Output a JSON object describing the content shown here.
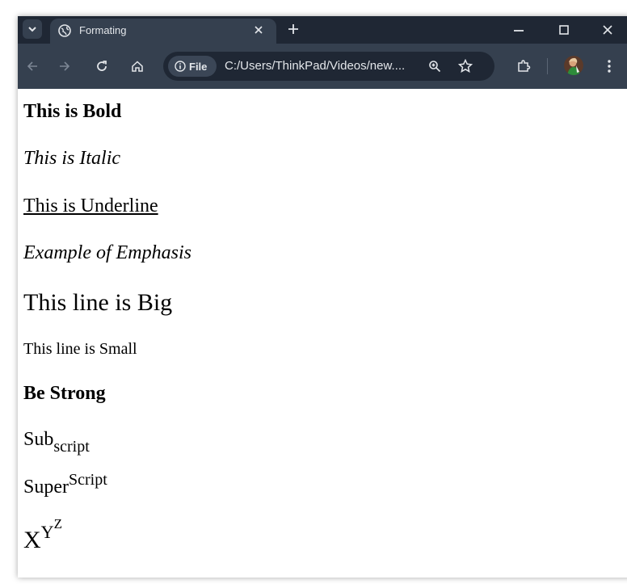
{
  "browser": {
    "tab": {
      "title": "Formating"
    },
    "omnibox": {
      "chip_label": "File",
      "url": "C:/Users/ThinkPad/Videos/new...."
    },
    "colors": {
      "tabstrip": "#1f2734",
      "toolbar": "#35404f",
      "icon": "#e3e6ea"
    }
  },
  "content": {
    "bold": "This is Bold",
    "italic": "This is Italic",
    "underline": "This is Underline",
    "emphasis": "Example of Emphasis",
    "big": "This line is Big",
    "small": "This line is Small",
    "strong": "Be Strong",
    "subscript_base": "Sub",
    "subscript_text": "script",
    "superscript_base": "Super",
    "superscript_text": "Script",
    "power_base": "X",
    "power_exp1": "Y",
    "power_exp2": "Z"
  }
}
